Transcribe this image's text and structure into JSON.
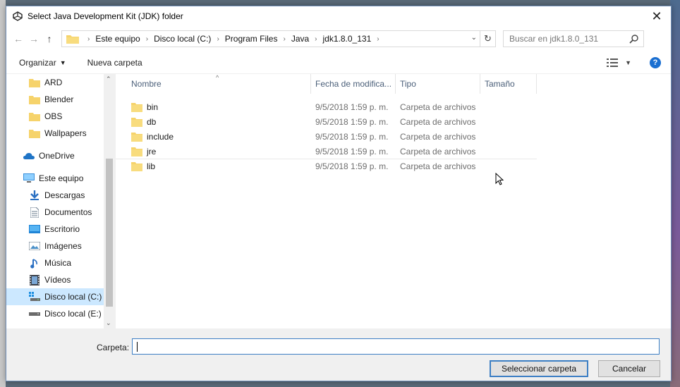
{
  "window": {
    "title": "Select Java Development Kit (JDK) folder"
  },
  "nav": {
    "back": "←",
    "forward": "→",
    "up": "↑",
    "breadcrumb": [
      "Este equipo",
      "Disco local (C:)",
      "Program Files",
      "Java",
      "jdk1.8.0_131"
    ],
    "search_placeholder": "Buscar en jdk1.8.0_131"
  },
  "toolbar": {
    "organize": "Organizar",
    "new_folder": "Nueva carpeta"
  },
  "sidebar": {
    "items": [
      {
        "label": "ARD",
        "icon": "folder-icon",
        "level": "sub"
      },
      {
        "label": "Blender",
        "icon": "folder-icon",
        "level": "sub"
      },
      {
        "label": "OBS",
        "icon": "folder-icon",
        "level": "sub"
      },
      {
        "label": "Wallpapers",
        "icon": "folder-icon",
        "level": "sub"
      },
      {
        "label": "OneDrive",
        "icon": "onedrive-icon",
        "level": "top"
      },
      {
        "label": "Este equipo",
        "icon": "computer-icon",
        "level": "top"
      },
      {
        "label": "Descargas",
        "icon": "downloads-icon",
        "level": "sub"
      },
      {
        "label": "Documentos",
        "icon": "documents-icon",
        "level": "sub"
      },
      {
        "label": "Escritorio",
        "icon": "desktop-icon",
        "level": "sub"
      },
      {
        "label": "Imágenes",
        "icon": "pictures-icon",
        "level": "sub"
      },
      {
        "label": "Música",
        "icon": "music-icon",
        "level": "sub"
      },
      {
        "label": "Vídeos",
        "icon": "videos-icon",
        "level": "sub"
      },
      {
        "label": "Disco local (C:)",
        "icon": "drive-c-icon",
        "level": "sub",
        "selected": true
      },
      {
        "label": "Disco local (E:)",
        "icon": "drive-icon",
        "level": "sub"
      }
    ]
  },
  "columns": {
    "name": "Nombre",
    "date": "Fecha de modifica...",
    "type": "Tipo",
    "size": "Tamaño"
  },
  "files": [
    {
      "name": "bin",
      "date": "9/5/2018 1:59 p. m.",
      "type": "Carpeta de archivos"
    },
    {
      "name": "db",
      "date": "9/5/2018 1:59 p. m.",
      "type": "Carpeta de archivos"
    },
    {
      "name": "include",
      "date": "9/5/2018 1:59 p. m.",
      "type": "Carpeta de archivos"
    },
    {
      "name": "jre",
      "date": "9/5/2018 1:59 p. m.",
      "type": "Carpeta de archivos"
    },
    {
      "name": "lib",
      "date": "9/5/2018 1:59 p. m.",
      "type": "Carpeta de archivos"
    }
  ],
  "footer": {
    "folder_label": "Carpeta:",
    "folder_value": "",
    "select_button": "Seleccionar carpeta",
    "cancel_button": "Cancelar"
  },
  "colors": {
    "accent": "#3d7fc4",
    "selected_bg": "#cce8ff",
    "folder": "#f6d36b",
    "help": "#1a6fd1"
  }
}
